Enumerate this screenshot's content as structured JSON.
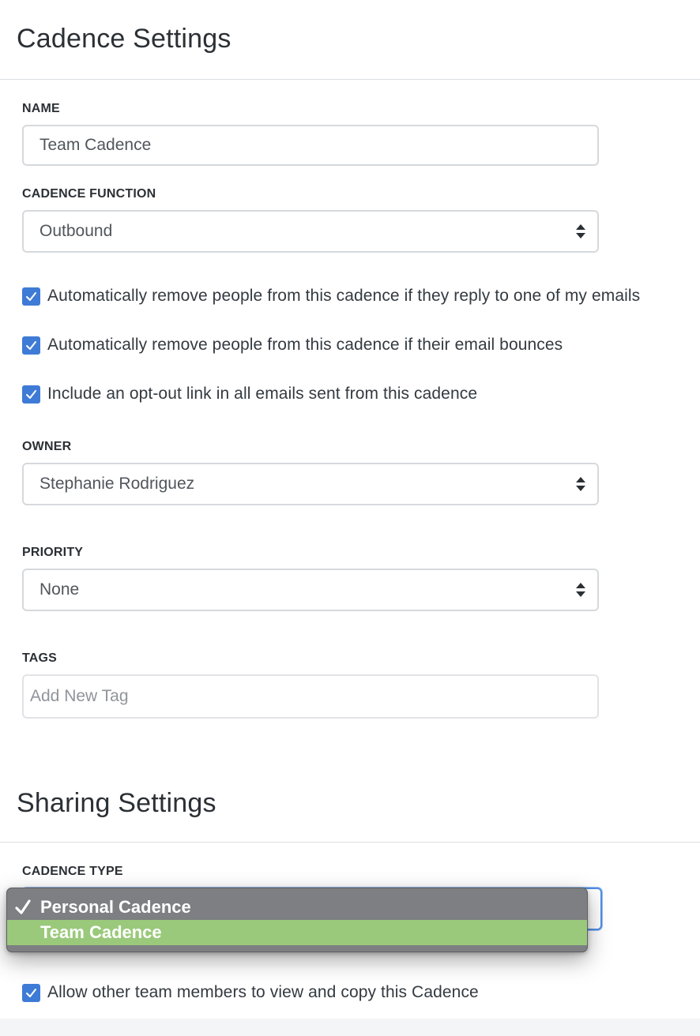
{
  "cadence_settings": {
    "title": "Cadence Settings",
    "name_label": "NAME",
    "name_value": "Team Cadence",
    "function_label": "CADENCE FUNCTION",
    "function_value": "Outbound",
    "checkboxes": [
      {
        "label": "Automatically remove people from this cadence if they reply to one of my emails",
        "checked": true
      },
      {
        "label": "Automatically remove people from this cadence if their email bounces",
        "checked": true
      },
      {
        "label": "Include an opt-out link in all emails sent from this cadence",
        "checked": true
      }
    ],
    "owner_label": "OWNER",
    "owner_value": "Stephanie Rodriguez",
    "priority_label": "PRIORITY",
    "priority_value": "None",
    "tags_label": "TAGS",
    "tags_placeholder": "Add New Tag"
  },
  "sharing_settings": {
    "title": "Sharing Settings",
    "type_label": "CADENCE TYPE",
    "type_options": [
      {
        "label": "Personal Cadence",
        "checked": true,
        "highlighted": false
      },
      {
        "label": "Team Cadence",
        "checked": false,
        "highlighted": true
      }
    ],
    "allow_copy": {
      "label": "Allow other team members to view and copy this Cadence",
      "checked": true
    }
  },
  "colors": {
    "checkbox": "#3e7bd6",
    "highlight": "#9ac97b",
    "popup_bg": "#7d7f82",
    "focus_ring": "#4f8ee6"
  },
  "icons": {
    "stepper": "up-down-arrows-icon",
    "checkbox": "checkmark-icon",
    "selected": "checkmark-icon"
  }
}
